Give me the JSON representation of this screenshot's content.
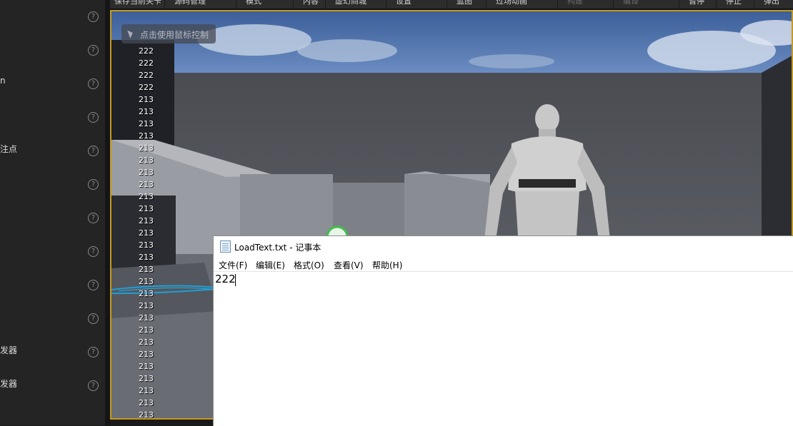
{
  "left_panel": {
    "rows": [
      {
        "label": ""
      },
      {
        "label": ""
      },
      {
        "label": "n"
      },
      {
        "label": ""
      },
      {
        "label": "注点"
      },
      {
        "label": ""
      },
      {
        "label": ""
      },
      {
        "label": ""
      },
      {
        "label": ""
      },
      {
        "label": ""
      },
      {
        "label": "发器"
      },
      {
        "label": "发器"
      }
    ],
    "help_glyph": "?"
  },
  "toolbar": {
    "items": [
      {
        "label": "保存当前关卡",
        "disabled": false
      },
      {
        "label": "源码管理",
        "disabled": false
      },
      {
        "label": "模式",
        "disabled": false
      },
      {
        "label": "内容",
        "disabled": false
      },
      {
        "label": "虚幻商城",
        "disabled": false
      },
      {
        "label": "设置",
        "disabled": false
      },
      {
        "label": "蓝图",
        "disabled": false
      },
      {
        "label": "过场动画",
        "disabled": false
      },
      {
        "label": "构建",
        "disabled": true
      },
      {
        "label": "编译",
        "disabled": true
      },
      {
        "label": "暂停",
        "disabled": false
      },
      {
        "label": "停止",
        "disabled": false
      },
      {
        "label": "弹出",
        "disabled": false
      }
    ]
  },
  "viewport": {
    "mouse_hint": "点击使用鼠标控制",
    "log_lines": [
      "222",
      "222",
      "222",
      "222",
      "213",
      "213",
      "213",
      "213",
      "213",
      "213",
      "213",
      "213",
      "213",
      "213",
      "213",
      "213",
      "213",
      "213",
      "213",
      "213",
      "213",
      "213",
      "213",
      "213",
      "213",
      "213",
      "213",
      "213",
      "213",
      "213",
      "213"
    ]
  },
  "notepad": {
    "title": "LoadText.txt - 记事本",
    "menus": [
      {
        "label": "文件(F)"
      },
      {
        "label": "编辑(E)"
      },
      {
        "label": "格式(O)"
      },
      {
        "label": "查看(V)"
      },
      {
        "label": "帮助(H)"
      }
    ],
    "content": "222"
  },
  "colors": {
    "viewport_border": "#c59a21",
    "panel_bg": "#242424"
  }
}
